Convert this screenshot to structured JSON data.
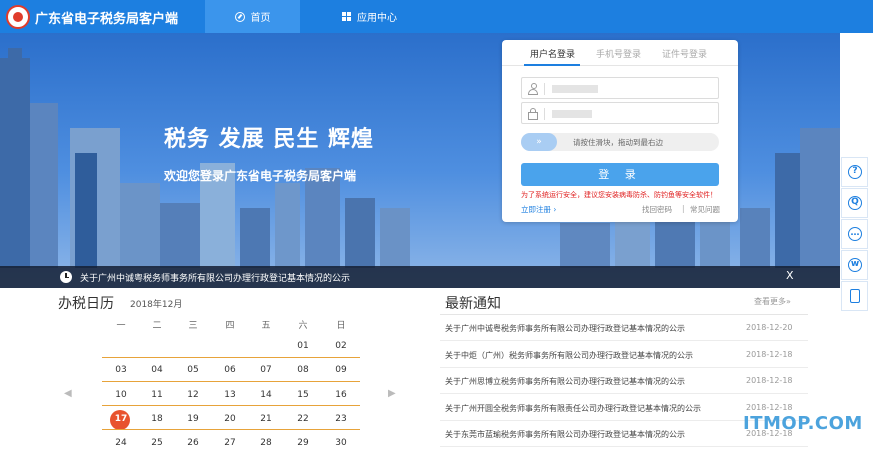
{
  "app": {
    "title": "广东省电子税务局客户端"
  },
  "nav": {
    "home": "首页",
    "apps": "应用中心"
  },
  "banner": {
    "slogan": "税务 发展 民生 辉煌",
    "welcome": "欢迎您登录广东省电子税务局客户端"
  },
  "notice_bar": {
    "text": "关于广州中诚粤税务师事务所有限公司办理行政登记基本情况的公示",
    "close": "X"
  },
  "login": {
    "tabs": [
      "用户名登录",
      "手机号登录",
      "证件号登录"
    ],
    "slider_arrows": "»",
    "slider_text": "请按住滑块，拖动到最右边",
    "button": "登 录",
    "warning": "为了系统运行安全，建议您安装病毒防杀、防钓鱼等安全软件！",
    "register": "立即注册 ›",
    "forgot": "找回密码",
    "sep": "|",
    "faq": "常见问题"
  },
  "rail": {
    "help": "?",
    "search": "Q",
    "chat": "…",
    "weibo": "w",
    "phone": ""
  },
  "calendar": {
    "title": "办税日历",
    "month": "2018年12月",
    "weekdays": [
      "一",
      "二",
      "三",
      "四",
      "五",
      "六",
      "日"
    ],
    "rows": [
      [
        "",
        "",
        "",
        "",
        "",
        "01",
        "02"
      ],
      [
        "03",
        "04",
        "05",
        "06",
        "07",
        "08",
        "09"
      ],
      [
        "10",
        "11",
        "12",
        "13",
        "14",
        "15",
        "16"
      ],
      [
        "17",
        "18",
        "19",
        "20",
        "21",
        "22",
        "23"
      ],
      [
        "24",
        "25",
        "26",
        "27",
        "28",
        "29",
        "30"
      ]
    ],
    "prev": "◀",
    "next": "▶"
  },
  "news": {
    "title": "最新通知",
    "more": "查看更多»",
    "items": [
      {
        "title": "关于广州中诚粤税务师事务所有限公司办理行政登记基本情况的公示",
        "date": "2018-12-20"
      },
      {
        "title": "关于中炬（广州）税务师事务所有限公司办理行政登记基本情况的公示",
        "date": "2018-12-18"
      },
      {
        "title": "关于广州思博立税务师事务所有限公司办理行政登记基本情况的公示",
        "date": "2018-12-18"
      },
      {
        "title": "关于广州开圆全税务师事务所有限责任公司办理行政登记基本情况的公示",
        "date": "2018-12-18"
      },
      {
        "title": "关于东莞市蓝瑜税务师事务所有限公司办理行政登记基本情况的公示",
        "date": "2018-12-18"
      }
    ]
  },
  "watermark": "ITMOP.COM"
}
